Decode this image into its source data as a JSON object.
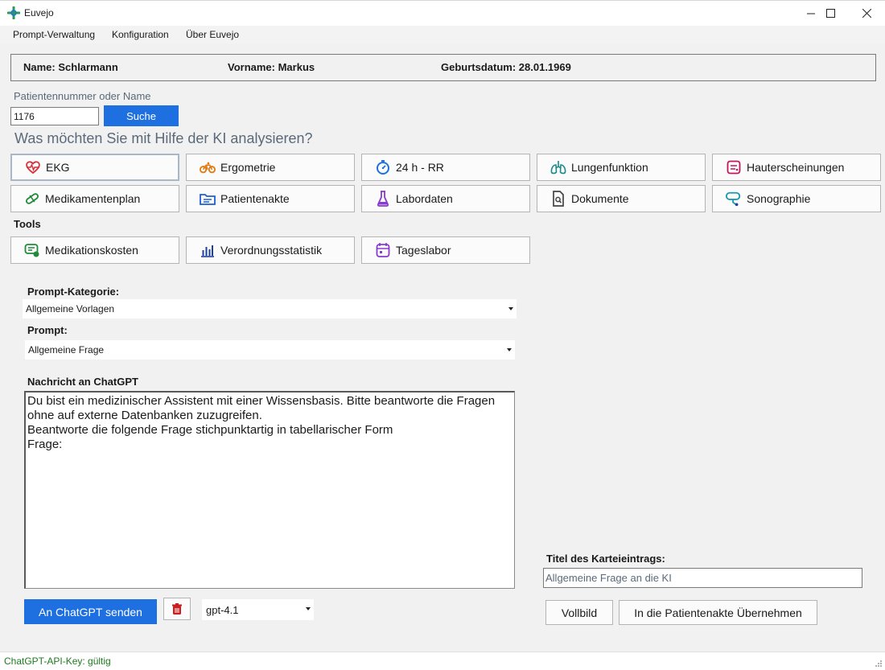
{
  "window": {
    "title": "Euvejo",
    "minimize_glyph": "—",
    "maximize_glyph": "☐",
    "close_glyph": "✕"
  },
  "menu": [
    "Prompt-Verwaltung",
    "Konfiguration",
    "Über Euvejo"
  ],
  "patient": {
    "name": "Name: Schlarmann",
    "vorname": "Vorname: Markus",
    "geburtsdatum": "Geburtsdatum: 28.01.1969"
  },
  "search": {
    "label": "Patientennummer oder Name",
    "value": "1176",
    "button": "Suche"
  },
  "question": "Was möchten Sie mit Hilfe der KI analysieren?",
  "analysis_buttons": [
    {
      "label": "EKG",
      "icon": "heart-pulse-icon",
      "color": "#d8313b"
    },
    {
      "label": "Ergometrie",
      "icon": "bicycle-icon",
      "color": "#e07a10"
    },
    {
      "label": "24 h - RR",
      "icon": "stopwatch-icon",
      "color": "#1e6fe0"
    },
    {
      "label": "Lungenfunktion",
      "icon": "lungs-icon",
      "color": "#1a8a8a"
    },
    {
      "label": "Hauterscheinungen",
      "icon": "skin-icon",
      "color": "#c2185b"
    },
    {
      "label": "Medikamentenplan",
      "icon": "pill-icon",
      "color": "#1f8a3a"
    },
    {
      "label": "Patientenakte",
      "icon": "folder-icon",
      "color": "#1e5fd0"
    },
    {
      "label": "Labordaten",
      "icon": "flask-icon",
      "color": "#8a3ad0"
    },
    {
      "label": "Dokumente",
      "icon": "document-icon",
      "color": "#444444"
    },
    {
      "label": "Sonographie",
      "icon": "ultrasound-icon",
      "color": "#1a9ab0"
    }
  ],
  "tools_label": "Tools",
  "tool_buttons": [
    {
      "label": "Medikationskosten",
      "icon": "cost-icon",
      "color": "#1f8a3a"
    },
    {
      "label": "Verordnungsstatistik",
      "icon": "bar-chart-icon",
      "color": "#1e3fa0"
    },
    {
      "label": "Tageslabor",
      "icon": "calendar-icon",
      "color": "#8a3ad0"
    }
  ],
  "prompt_category": {
    "label": "Prompt-Kategorie:",
    "value": "Allgemeine Vorlagen"
  },
  "prompt": {
    "label": "Prompt:",
    "value": "Allgemeine Frage"
  },
  "message": {
    "label": "Nachricht an ChatGPT",
    "value": "Du bist ein medizinischer Assistent mit einer Wissensbasis. Bitte beantworte die Fragen ohne auf externe Datenbanken zuzugreifen.\nBeantworte die folgende Frage stichpunktartig in tabellarischer Form\nFrage:"
  },
  "send_button": "An ChatGPT senden",
  "model": {
    "value": "gpt-4.1"
  },
  "karteieintrag": {
    "label": "Titel des Karteieintrags:",
    "value": "Allgemeine Frage an die KI"
  },
  "vollbild_button": "Vollbild",
  "uebernehmen_button": "In die Patientenakte Übernehmen",
  "status": "ChatGPT-API-Key: gültig"
}
